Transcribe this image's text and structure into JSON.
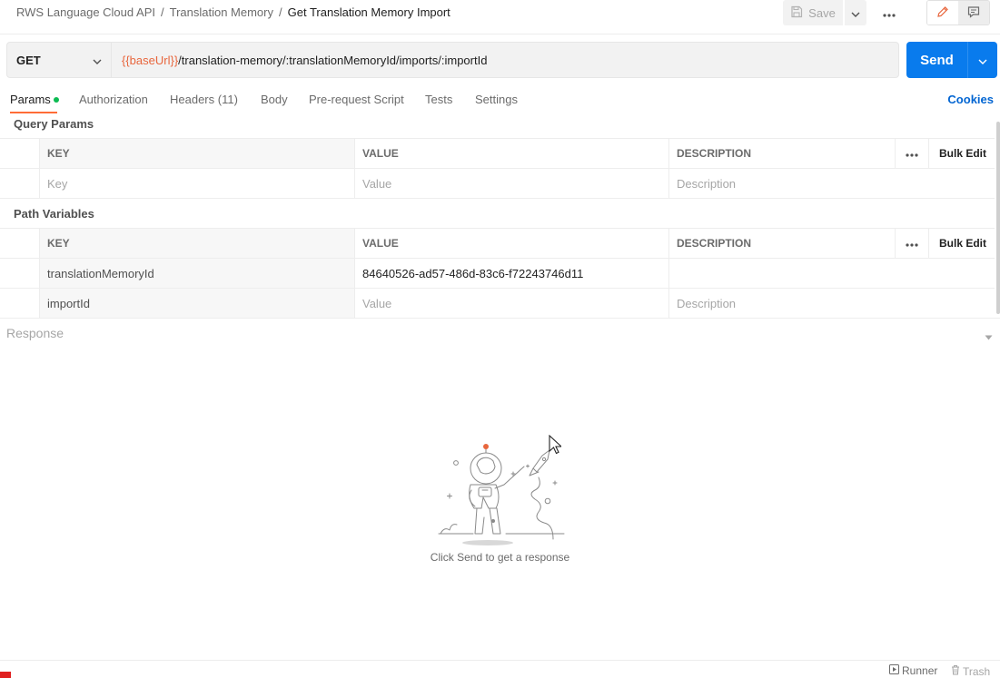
{
  "breadcrumb": {
    "items": [
      "RWS Language Cloud API",
      "Translation Memory"
    ],
    "separator": "/",
    "current": "Get Translation Memory Import"
  },
  "toolbar": {
    "save_label": "Save",
    "save_icon": "save-icon",
    "more_icon": "more-horizontal-icon",
    "edit_icon": "pencil-icon",
    "comment_icon": "comment-icon"
  },
  "request": {
    "method": "GET",
    "url_variable": "{{baseUrl}}",
    "url_path": "/translation-memory/:translationMemoryId/imports/:importId",
    "send_label": "Send"
  },
  "tabs": [
    {
      "label": "Params",
      "active": true,
      "has_dot": true
    },
    {
      "label": "Authorization"
    },
    {
      "label": "Headers (11)"
    },
    {
      "label": "Body"
    },
    {
      "label": "Pre-request Script"
    },
    {
      "label": "Tests"
    },
    {
      "label": "Settings"
    }
  ],
  "cookies_label": "Cookies",
  "query_params": {
    "title": "Query Params",
    "headers": {
      "key": "KEY",
      "value": "VALUE",
      "description": "DESCRIPTION",
      "bulk_edit": "Bulk Edit"
    },
    "placeholder_row": {
      "key": "Key",
      "value": "Value",
      "description": "Description"
    }
  },
  "path_variables": {
    "title": "Path Variables",
    "headers": {
      "key": "KEY",
      "value": "VALUE",
      "description": "DESCRIPTION",
      "bulk_edit": "Bulk Edit"
    },
    "rows": [
      {
        "key": "translationMemoryId",
        "value": "84640526-ad57-486d-83c6-f72243746d11",
        "description": ""
      },
      {
        "key": "importId",
        "value_placeholder": "Value",
        "description_placeholder": "Description"
      }
    ]
  },
  "response": {
    "title": "Response",
    "empty_message": "Click Send to get a response",
    "illustration": "astronaut-rocket-illustration"
  },
  "statusbar": {
    "runner_label": "Runner",
    "trash_label": "Trash"
  },
  "colors": {
    "accent": "#ff6c37",
    "send_blue": "#097bed",
    "link_blue": "#0265d2",
    "variable_orange": "#e8663d",
    "status_dot": "#0cbb52"
  }
}
